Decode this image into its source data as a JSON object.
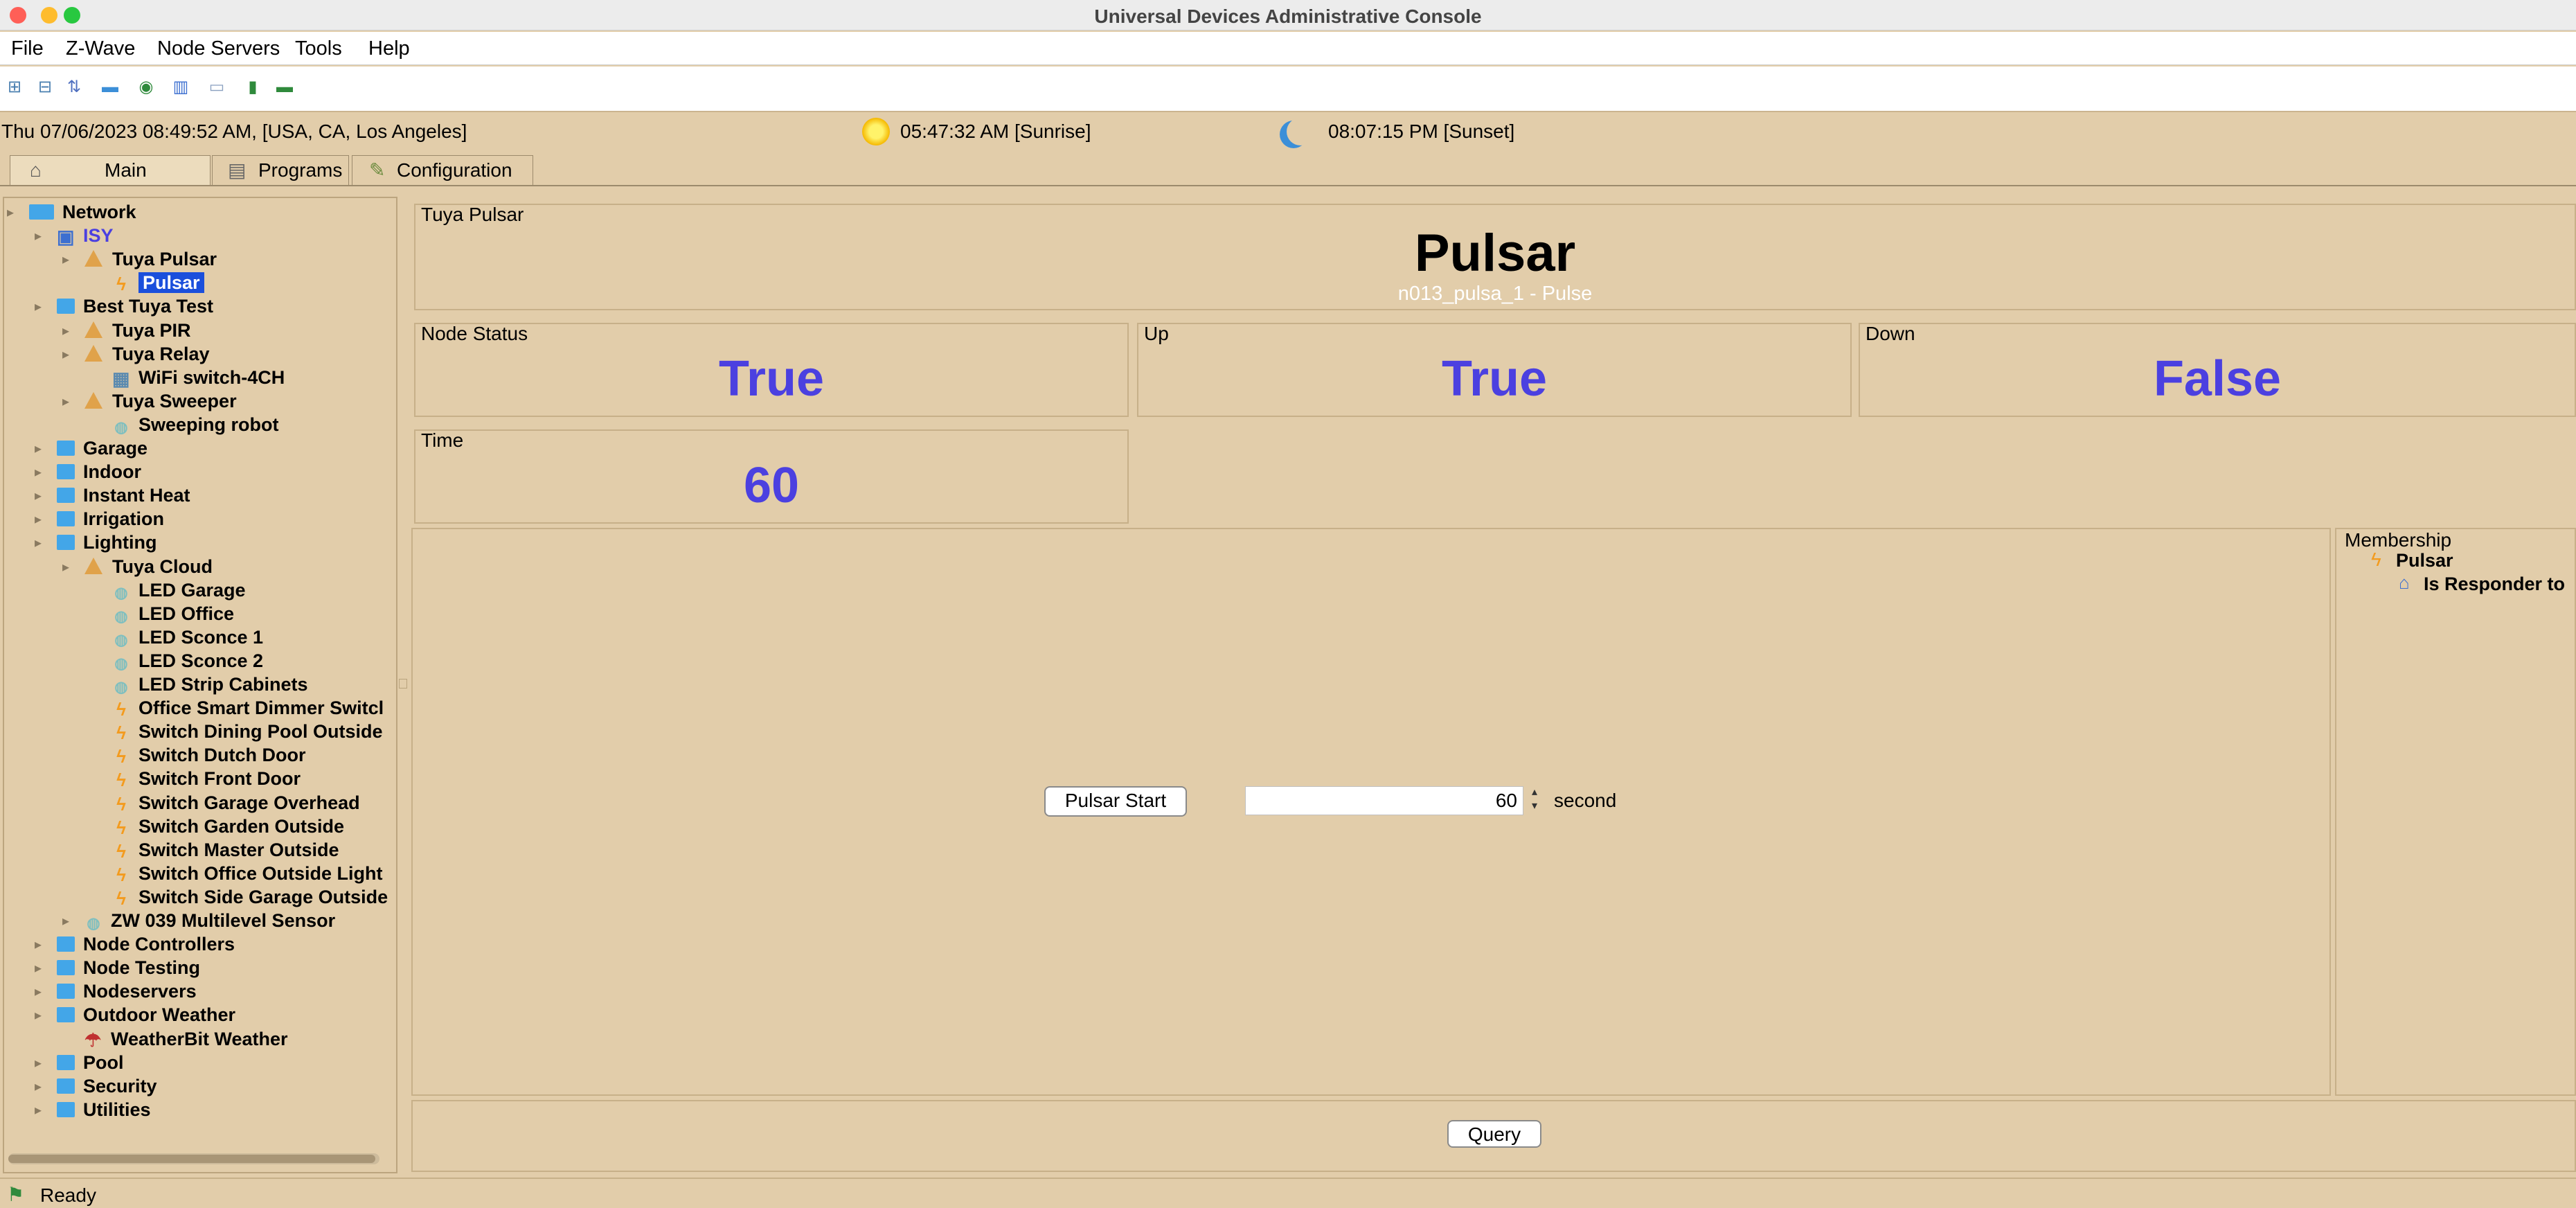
{
  "window": {
    "title": "Universal Devices Administrative Console"
  },
  "menu": [
    "File",
    "Z-Wave",
    "Node Servers",
    "Tools",
    "Help"
  ],
  "toolbar_icons": [
    "expand-icon",
    "collapse-icon",
    "sort-icon",
    "folder-icon",
    "network-icon",
    "chart-icon",
    "window-icon",
    "battery-icon",
    "plug-icon"
  ],
  "info": {
    "datetime": "Thu 07/06/2023 08:49:52 AM,  [USA, CA, Los Angeles]",
    "sunrise": "05:47:32 AM [Sunrise]",
    "sunset": "08:07:15 PM [Sunset]"
  },
  "tabs": [
    "Main",
    "Programs",
    "Configuration"
  ],
  "tree": [
    {
      "label": "Network",
      "icon": "network-icon"
    },
    {
      "label": "ISY",
      "icon": "computer-icon"
    },
    {
      "label": "Tuya Pulsar",
      "icon": "warning-icon"
    },
    {
      "label": "Pulsar",
      "icon": "bolt-icon"
    },
    {
      "label": "Best Tuya Test",
      "icon": "folder-icon"
    },
    {
      "label": "Tuya PIR",
      "icon": "warning-icon"
    },
    {
      "label": "Tuya Relay",
      "icon": "warning-icon"
    },
    {
      "label": "WiFi switch-4CH",
      "icon": "relay-icon"
    },
    {
      "label": "Tuya Sweeper",
      "icon": "warning-icon"
    },
    {
      "label": "Sweeping robot",
      "icon": "bulb-icon"
    },
    {
      "label": "Garage",
      "icon": "folder-icon"
    },
    {
      "label": "Indoor",
      "icon": "folder-icon"
    },
    {
      "label": "Instant Heat",
      "icon": "folder-icon"
    },
    {
      "label": "Irrigation",
      "icon": "folder-icon"
    },
    {
      "label": "Lighting",
      "icon": "folder-icon"
    },
    {
      "label": "Tuya Cloud",
      "icon": "warning-icon"
    },
    {
      "label": "LED Garage",
      "icon": "bulb-icon"
    },
    {
      "label": "LED Office",
      "icon": "bulb-icon"
    },
    {
      "label": "LED Sconce 1",
      "icon": "bulb-icon"
    },
    {
      "label": "LED Sconce 2",
      "icon": "bulb-icon"
    },
    {
      "label": "LED Strip Cabinets",
      "icon": "bulb-icon"
    },
    {
      "label": "Office Smart Dimmer Switcl",
      "icon": "bolt-icon"
    },
    {
      "label": "Switch Dining Pool Outside",
      "icon": "bolt-icon"
    },
    {
      "label": "Switch Dutch Door",
      "icon": "bolt-icon"
    },
    {
      "label": "Switch Front Door",
      "icon": "bolt-icon"
    },
    {
      "label": "Switch Garage Overhead",
      "icon": "bolt-icon"
    },
    {
      "label": "Switch Garden Outside",
      "icon": "bolt-icon"
    },
    {
      "label": "Switch Master Outside",
      "icon": "bolt-icon"
    },
    {
      "label": "Switch Office Outside Light",
      "icon": "bolt-icon"
    },
    {
      "label": "Switch Side Garage Outside",
      "icon": "bolt-icon"
    },
    {
      "label": "ZW 039 Multilevel Sensor",
      "icon": "bulb-icon"
    },
    {
      "label": "Node Controllers",
      "icon": "folder-icon"
    },
    {
      "label": "Node Testing",
      "icon": "folder-icon"
    },
    {
      "label": "Nodeservers",
      "icon": "folder-icon"
    },
    {
      "label": "Outdoor Weather",
      "icon": "folder-icon"
    },
    {
      "label": "WeatherBit Weather",
      "icon": "weather-icon"
    },
    {
      "label": "Pool",
      "icon": "folder-icon"
    },
    {
      "label": "Security",
      "icon": "folder-icon"
    },
    {
      "label": "Utilities",
      "icon": "folder-icon"
    }
  ],
  "node": {
    "group_label": "Tuya Pulsar",
    "name": "Pulsar",
    "address": "n013_pulsa_1 - Pulse"
  },
  "properties": {
    "node_status": {
      "label": "Node Status",
      "value": "True"
    },
    "up": {
      "label": "Up",
      "value": "True"
    },
    "down": {
      "label": "Down",
      "value": "False"
    },
    "time": {
      "label": "Time",
      "value": "60"
    }
  },
  "controls": {
    "start_button": "Pulsar Start",
    "duration": "60",
    "unit": "second",
    "query_button": "Query"
  },
  "membership": {
    "label": "Membership",
    "node": "Pulsar",
    "relation": "Is Responder to"
  },
  "status": {
    "text": "Ready"
  },
  "colors": {
    "value_text": "#4b40e0",
    "background": "#e2cdaa",
    "selection": "#1b4fdc"
  }
}
